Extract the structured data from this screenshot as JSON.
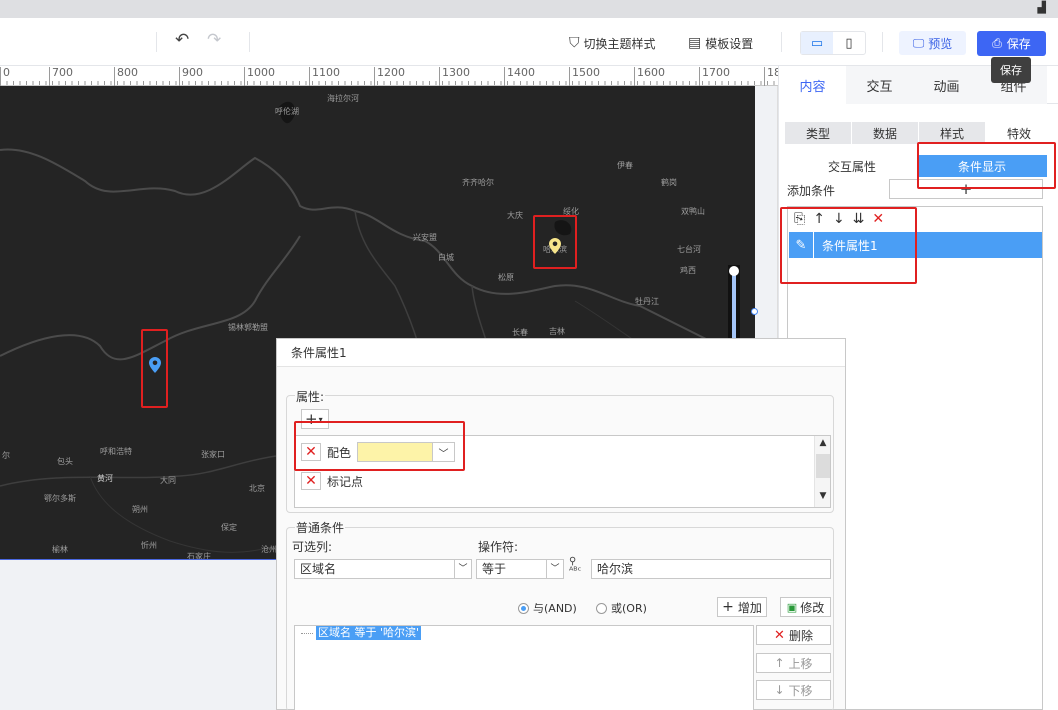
{
  "toolbar": {
    "theme_label": "切换主题样式",
    "template_label": "模板设置",
    "preview_label": "预览",
    "save_label": "保存",
    "save_tooltip": "保存"
  },
  "ruler": {
    "labels": [
      "700",
      "800",
      "900",
      "1000",
      "1100",
      "1200",
      "1300",
      "1400",
      "1500",
      "1600",
      "1700"
    ]
  },
  "map": {
    "labels": [
      "海拉尔河",
      "呼伦湖",
      "齐齐哈尔",
      "伊春",
      "鹤岗",
      "大庆",
      "绥化",
      "双鸭山",
      "兴安盟",
      "白城",
      "哈尔滨",
      "七台河",
      "松原",
      "鸡西",
      "锡林郭勒盟",
      "牡丹江",
      "长春",
      "吉林",
      "尔",
      "包头",
      "呼和浩特",
      "张家口",
      "黄河",
      "大同",
      "北京",
      "鄂尔多斯",
      "朔州",
      "保定",
      "榆林",
      "忻州",
      "石家庄",
      "沧州"
    ]
  },
  "right_panel": {
    "tabs": [
      "内容",
      "交互",
      "动画",
      "组件"
    ],
    "sub_tabs": [
      "类型",
      "数据",
      "样式",
      "特效"
    ],
    "cond_tabs": [
      "交互属性",
      "条件显示"
    ],
    "add_condition_label": "添加条件",
    "condition_items": [
      "条件属性1"
    ]
  },
  "dialog": {
    "title": "条件属性1",
    "attr_group_label": "属性:",
    "attrs": [
      "配色",
      "标记点"
    ],
    "common_group_label": "普通条件",
    "col_label": "可选列:",
    "op_label": "操作符:",
    "col_value": "区域名",
    "op_value": "等于",
    "value_text": "哈尔滨",
    "and_label": "与(AND)",
    "or_label": "或(OR)",
    "add_label": "增加",
    "modify_label": "修改",
    "delete_label": "删除",
    "up_label": "上移",
    "down_label": "下移",
    "condition_text": "区域名 等于 '哈尔滨'"
  },
  "colors": {
    "accent": "#3d66f4",
    "highlight": "#4a9ef5",
    "marker_box": "#e02020",
    "color_swatch": "#fdf3a8"
  }
}
